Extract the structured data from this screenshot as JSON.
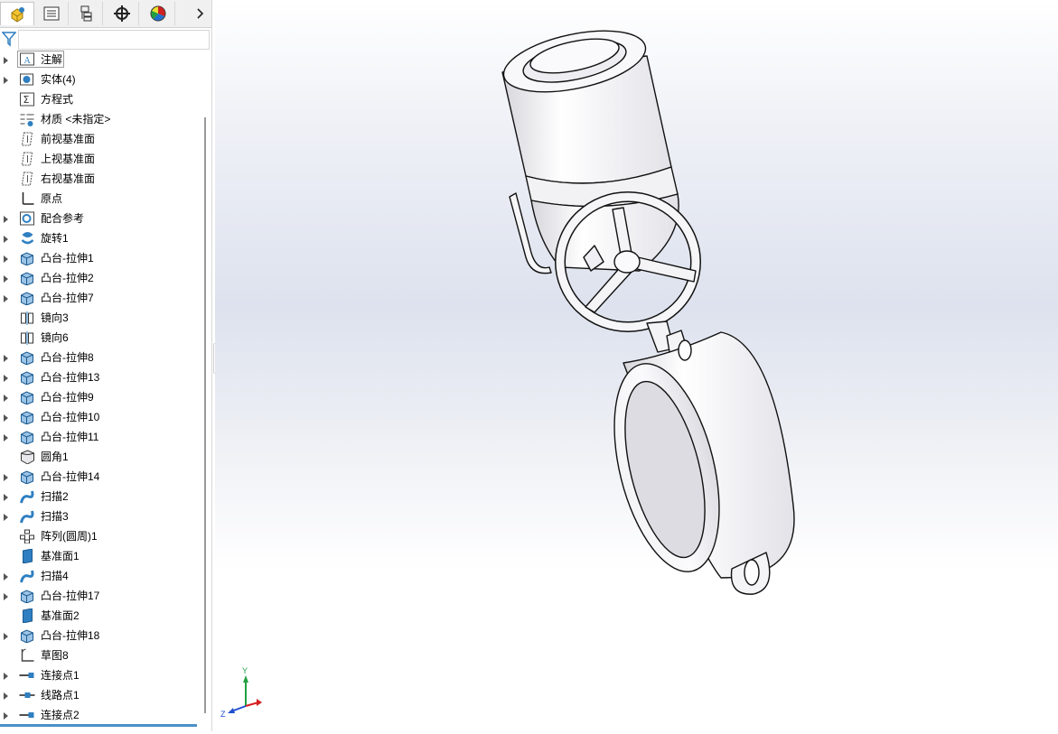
{
  "tabs": [
    {
      "name": "feature-manager-tab",
      "icon": "feature-manager-icon"
    },
    {
      "name": "property-manager-tab",
      "icon": "property-manager-icon"
    },
    {
      "name": "configuration-manager-tab",
      "icon": "configuration-manager-icon"
    },
    {
      "name": "dimxpert-manager-tab",
      "icon": "dimxpert-icon"
    },
    {
      "name": "display-manager-tab",
      "icon": "display-manager-icon"
    }
  ],
  "tree": [
    {
      "label": "注解",
      "icon": "annotation-icon",
      "expandable": true,
      "selected": true
    },
    {
      "label": "实体(4)",
      "icon": "solid-bodies-icon",
      "expandable": true
    },
    {
      "label": "方程式",
      "icon": "equation-icon",
      "expandable": false
    },
    {
      "label": "材质 <未指定>",
      "icon": "material-icon",
      "expandable": false
    },
    {
      "label": "前视基准面",
      "icon": "plane-icon",
      "expandable": false
    },
    {
      "label": "上视基准面",
      "icon": "plane-icon",
      "expandable": false
    },
    {
      "label": "右视基准面",
      "icon": "plane-icon",
      "expandable": false
    },
    {
      "label": "原点",
      "icon": "origin-icon",
      "expandable": false
    },
    {
      "label": "配合参考",
      "icon": "mate-reference-icon",
      "expandable": true
    },
    {
      "label": "旋转1",
      "icon": "revolve-icon",
      "expandable": true
    },
    {
      "label": "凸台-拉伸1",
      "icon": "boss-extrude-icon",
      "expandable": true
    },
    {
      "label": "凸台-拉伸2",
      "icon": "boss-extrude-icon",
      "expandable": true
    },
    {
      "label": "凸台-拉伸7",
      "icon": "boss-extrude-icon",
      "expandable": true
    },
    {
      "label": "镜向3",
      "icon": "mirror-icon",
      "expandable": false
    },
    {
      "label": "镜向6",
      "icon": "mirror-icon",
      "expandable": false
    },
    {
      "label": "凸台-拉伸8",
      "icon": "boss-extrude-icon",
      "expandable": true
    },
    {
      "label": "凸台-拉伸13",
      "icon": "boss-extrude-icon",
      "expandable": true
    },
    {
      "label": "凸台-拉伸9",
      "icon": "boss-extrude-icon",
      "expandable": true
    },
    {
      "label": "凸台-拉伸10",
      "icon": "boss-extrude-icon",
      "expandable": true
    },
    {
      "label": "凸台-拉伸11",
      "icon": "boss-extrude-icon",
      "expandable": true
    },
    {
      "label": "圆角1",
      "icon": "fillet-icon",
      "expandable": false
    },
    {
      "label": "凸台-拉伸14",
      "icon": "boss-extrude-icon",
      "expandable": true
    },
    {
      "label": "扫描2",
      "icon": "sweep-icon",
      "expandable": true
    },
    {
      "label": "扫描3",
      "icon": "sweep-icon",
      "expandable": true
    },
    {
      "label": "阵列(圆周)1",
      "icon": "circular-pattern-icon",
      "expandable": false
    },
    {
      "label": "基准面1",
      "icon": "reference-plane-icon",
      "expandable": false
    },
    {
      "label": "扫描4",
      "icon": "sweep-icon",
      "expandable": true
    },
    {
      "label": "凸台-拉伸17",
      "icon": "boss-extrude-icon",
      "expandable": true
    },
    {
      "label": "基准面2",
      "icon": "reference-plane-icon",
      "expandable": false
    },
    {
      "label": "凸台-拉伸18",
      "icon": "boss-extrude-icon",
      "expandable": true
    },
    {
      "label": "草图8",
      "icon": "sketch-icon",
      "expandable": false
    },
    {
      "label": "连接点1",
      "icon": "connection-point-icon",
      "expandable": true
    },
    {
      "label": "线路点1",
      "icon": "route-point-icon",
      "expandable": true
    },
    {
      "label": "连接点2",
      "icon": "connection-point-icon",
      "expandable": true
    }
  ],
  "colors": {
    "accent": "#4a90c8",
    "icon_blue": "#2f7fc1",
    "model_fill": "#f6f6f8",
    "model_shade": "#d4d4da",
    "axis_x": "#d62020",
    "axis_y": "#20a040",
    "axis_z": "#2050d0"
  },
  "triad": {
    "x_label": "",
    "y_label": "Y",
    "z_label": "Z"
  }
}
